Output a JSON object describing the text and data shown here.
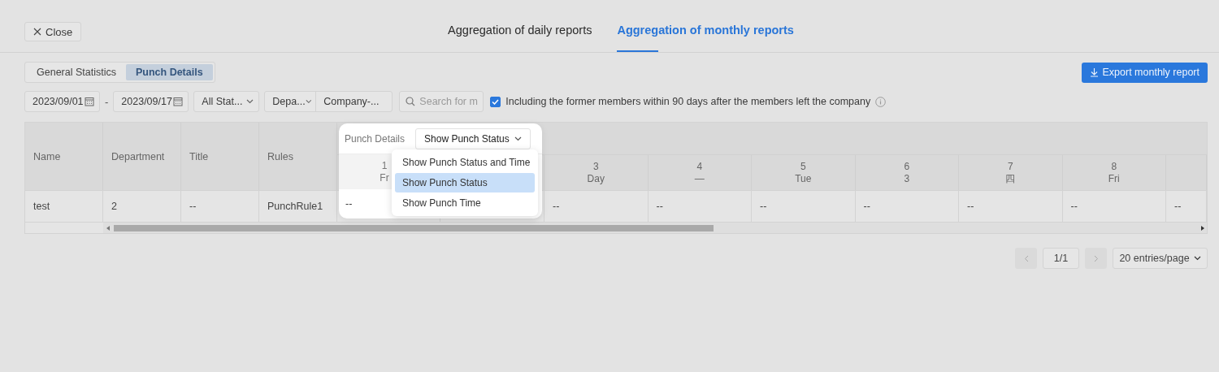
{
  "header": {
    "close_label": "Close",
    "tabs": [
      {
        "label": "Aggregation of daily reports",
        "selected": false
      },
      {
        "label": "Aggregation of monthly reports",
        "selected": true
      }
    ]
  },
  "view_tabs": [
    {
      "label": "General Statistics",
      "selected": false
    },
    {
      "label": "Punch Details",
      "selected": true
    }
  ],
  "export_button": "Export monthly report",
  "filters": {
    "start_date": "2023/09/01",
    "separator": "-",
    "end_date": "2023/09/17",
    "status": "All Stat...",
    "department": "Depa...",
    "company": "Company-...",
    "search_placeholder": "Search for m",
    "former_members": {
      "label": "Including the former members within 90 days after the members left the company",
      "checked": true
    }
  },
  "table": {
    "columns": [
      "Name",
      "Department",
      "Title",
      "Rules"
    ],
    "days": [
      {
        "day": "1",
        "weekday": "Fr"
      },
      {
        "day": "3",
        "weekday": "Day"
      },
      {
        "day": "4",
        "weekday": "—"
      },
      {
        "day": "5",
        "weekday": "Tue"
      },
      {
        "day": "6",
        "weekday": "3"
      },
      {
        "day": "7",
        "weekday": "四"
      },
      {
        "day": "8",
        "weekday": "Fri"
      }
    ],
    "rows": [
      {
        "cells": [
          "test",
          "2",
          "--",
          "PunchRule1"
        ],
        "day_cells": [
          "--",
          "--",
          "--",
          "--",
          "--",
          "--",
          "--",
          "--"
        ]
      }
    ]
  },
  "display_popup": {
    "label": "Punch Details",
    "value": "Show Punch Status",
    "options": [
      {
        "label": "Show Punch Status and Time",
        "selected": false
      },
      {
        "label": "Show Punch Status",
        "selected": true
      },
      {
        "label": "Show Punch Time",
        "selected": false
      }
    ]
  },
  "pagination": {
    "page": "1/1",
    "page_size": "20 entries/page"
  }
}
